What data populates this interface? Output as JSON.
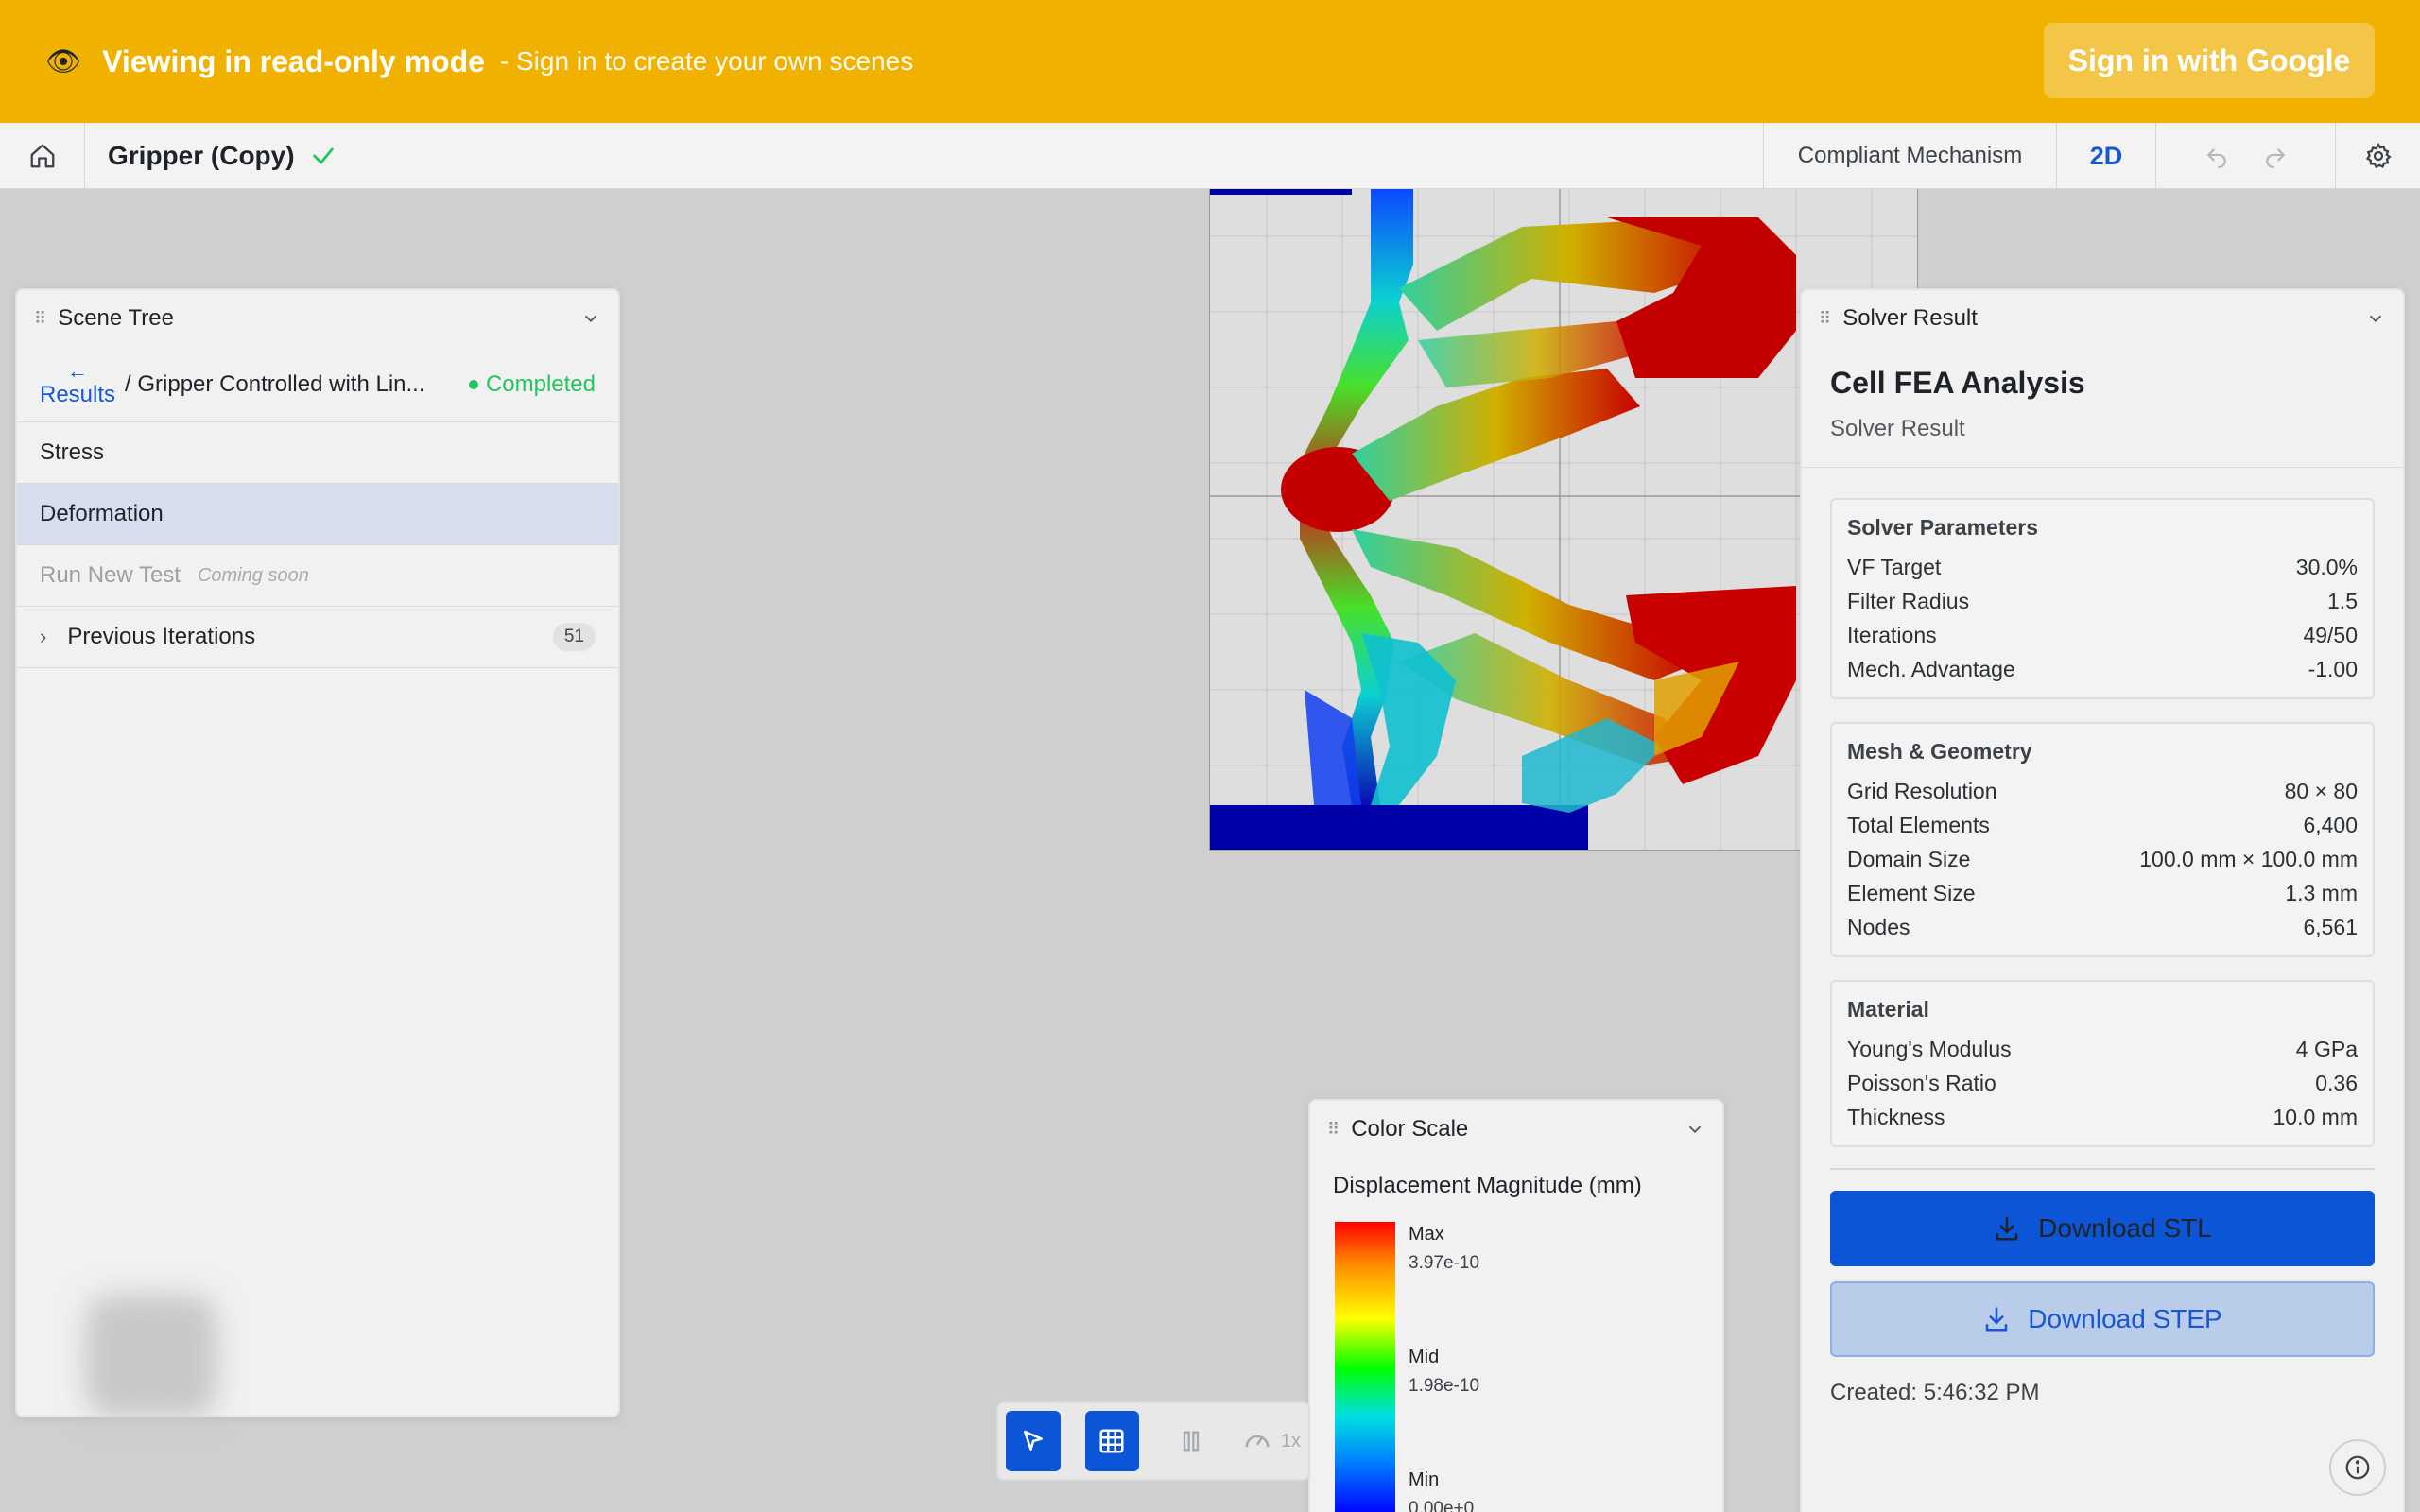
{
  "banner": {
    "title": "Viewing in read-only mode",
    "subtitle": "- Sign in to create your own scenes",
    "signin_label": "Sign in with Google",
    "color": "#f0b100"
  },
  "toolbar": {
    "title": "Gripper (Copy)",
    "mode": "Compliant Mechanism",
    "view": "2D"
  },
  "scene_tree": {
    "title": "Scene Tree",
    "back_label": "Results",
    "path": "/ Gripper Controlled with Lin...",
    "status": "Completed",
    "items": [
      {
        "label": "Stress"
      },
      {
        "label": "Deformation"
      },
      {
        "label": "Run New Test",
        "note": "Coming soon"
      },
      {
        "label": "Previous Iterations",
        "count": "51"
      }
    ]
  },
  "solver": {
    "panel_title": "Solver Result",
    "heading": "Cell FEA Analysis",
    "subheading": "Solver Result",
    "params": {
      "title": "Solver Parameters",
      "rows": [
        {
          "k": "VF Target",
          "v": "30.0%"
        },
        {
          "k": "Filter Radius",
          "v": "1.5"
        },
        {
          "k": "Iterations",
          "v": "49/50"
        },
        {
          "k": "Mech. Advantage",
          "v": "-1.00"
        }
      ]
    },
    "mesh": {
      "title": "Mesh & Geometry",
      "rows": [
        {
          "k": "Grid Resolution",
          "v": "80 × 80"
        },
        {
          "k": "Total Elements",
          "v": "6,400"
        },
        {
          "k": "Domain Size",
          "v": "100.0 mm × 100.0 mm"
        },
        {
          "k": "Element Size",
          "v": "1.3 mm"
        },
        {
          "k": "Nodes",
          "v": "6,561"
        }
      ]
    },
    "material": {
      "title": "Material",
      "rows": [
        {
          "k": "Young's Modulus",
          "v": "4 GPa"
        },
        {
          "k": "Poisson's Ratio",
          "v": "0.36"
        },
        {
          "k": "Thickness",
          "v": "10.0 mm"
        }
      ]
    },
    "download_stl": "Download STL",
    "download_step": "Download STEP",
    "created": "Created: 5:46:32 PM"
  },
  "color_scale": {
    "title": "Color Scale",
    "label": "Displacement Magnitude (mm)",
    "max_label": "Max",
    "max_value": "3.97e-10",
    "mid_label": "Mid",
    "mid_value": "1.98e-10",
    "min_label": "Min",
    "min_value": "0.00e+0"
  },
  "mini_toolbar": {
    "speed": "1x"
  }
}
